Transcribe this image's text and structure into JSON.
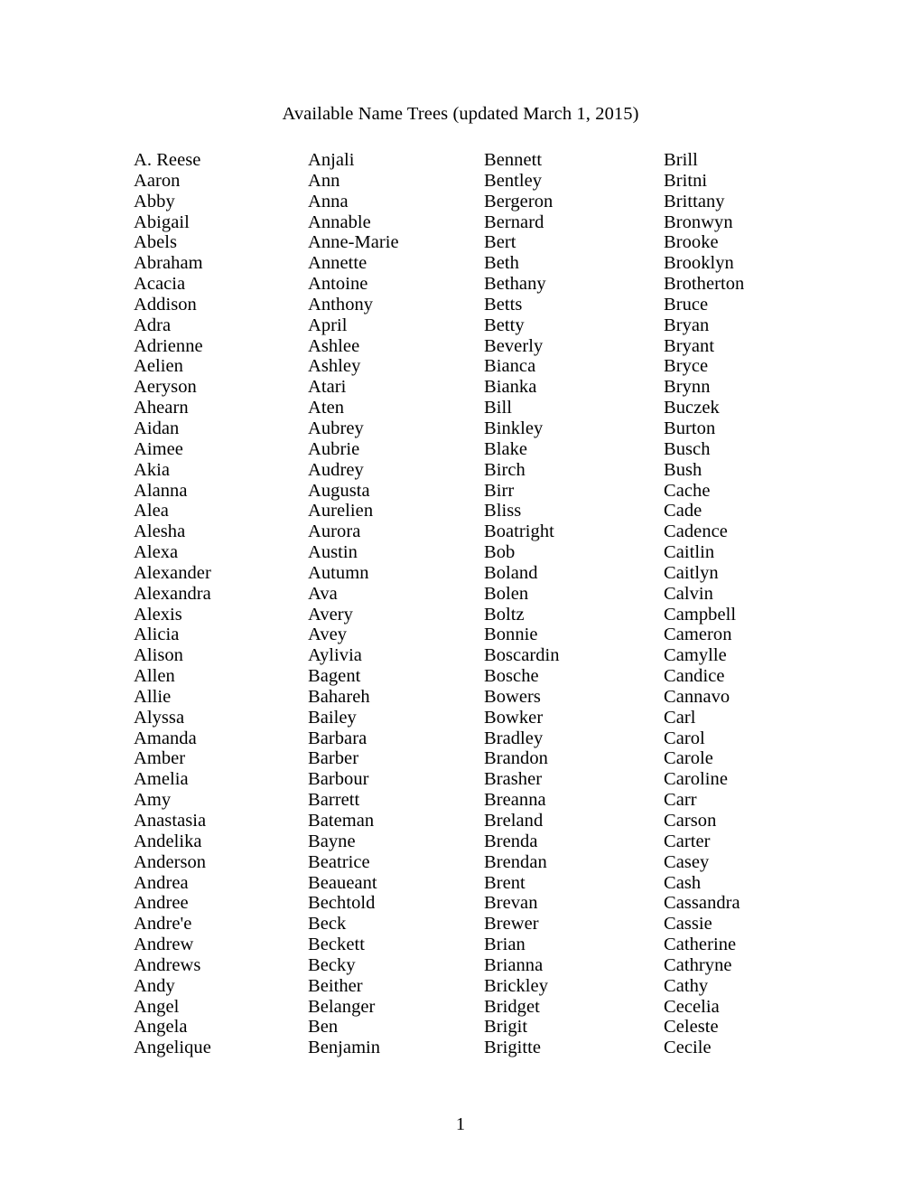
{
  "document": {
    "title": "Available Name Trees (updated March 1, 2015)",
    "page_number": "1"
  },
  "columns": [
    {
      "id": "column-1",
      "names": [
        "A. Reese",
        "Aaron",
        "Abby",
        "Abigail",
        "Abels",
        "Abraham",
        "Acacia",
        "Addison",
        "Adra",
        "Adrienne",
        "Aelien",
        "Aeryson",
        "Ahearn",
        "Aidan",
        "Aimee",
        "Akia",
        "Alanna",
        "Alea",
        "Alesha",
        "Alexa",
        "Alexander",
        "Alexandra",
        "Alexis",
        "Alicia",
        "Alison",
        "Allen",
        "Allie",
        "Alyssa",
        "Amanda",
        "Amber",
        "Amelia",
        "Amy",
        "Anastasia",
        "Andelika",
        "Anderson",
        "Andrea",
        "Andree",
        "Andre'e",
        "Andrew",
        "Andrews",
        "Andy",
        "Angel",
        "Angela",
        "Angelique"
      ]
    },
    {
      "id": "column-2",
      "names": [
        "Anjali",
        "Ann",
        "Anna",
        "Annable",
        "Anne-Marie",
        "Annette",
        "Antoine",
        "Anthony",
        "April",
        "Ashlee",
        "Ashley",
        "Atari",
        "Aten",
        "Aubrey",
        "Aubrie",
        "Audrey",
        "Augusta",
        "Aurelien",
        "Aurora",
        "Austin",
        "Autumn",
        "Ava",
        "Avery",
        "Avey",
        "Aylivia",
        "Bagent",
        "Bahareh",
        "Bailey",
        "Barbara",
        "Barber",
        "Barbour",
        "Barrett",
        "Bateman",
        "Bayne",
        "Beatrice",
        "Beaueant",
        "Bechtold",
        "Beck",
        "Beckett",
        "Becky",
        "Beither",
        "Belanger",
        "Ben",
        "Benjamin"
      ]
    },
    {
      "id": "column-3",
      "names": [
        "Bennett",
        "Bentley",
        "Bergeron",
        "Bernard",
        "Bert",
        "Beth",
        "Bethany",
        "Betts",
        "Betty",
        "Beverly",
        "Bianca",
        "Bianka",
        "Bill",
        "Binkley",
        "Blake",
        "Birch",
        "Birr",
        "Bliss",
        "Boatright",
        "Bob",
        "Boland",
        "Bolen",
        "Boltz",
        "Bonnie",
        "Boscardin",
        "Bosche",
        "Bowers",
        "Bowker",
        "Bradley",
        "Brandon",
        "Brasher",
        "Breanna",
        "Breland",
        "Brenda",
        "Brendan",
        "Brent",
        "Brevan",
        "Brewer",
        "Brian",
        "Brianna",
        "Brickley",
        "Bridget",
        "Brigit",
        "Brigitte"
      ]
    },
    {
      "id": "column-4",
      "names": [
        "Brill",
        "Britni",
        "Brittany",
        "Bronwyn",
        "Brooke",
        "Brooklyn",
        "Brotherton",
        "Bruce",
        "Bryan",
        "Bryant",
        "Bryce",
        "Brynn",
        "Buczek",
        "Burton",
        "Busch",
        "Bush",
        "Cache",
        "Cade",
        "Cadence",
        "Caitlin",
        "Caitlyn",
        "Calvin",
        "Campbell",
        "Cameron",
        "Camylle",
        "Candice",
        "Cannavo",
        "Carl",
        "Carol",
        "Carole",
        "Caroline",
        "Carr",
        "Carson",
        "Carter",
        "Casey",
        "Cash",
        "Cassandra",
        "Cassie",
        "Catherine",
        "Cathryne",
        "Cathy",
        "Cecelia",
        "Celeste",
        "Cecile"
      ]
    }
  ]
}
